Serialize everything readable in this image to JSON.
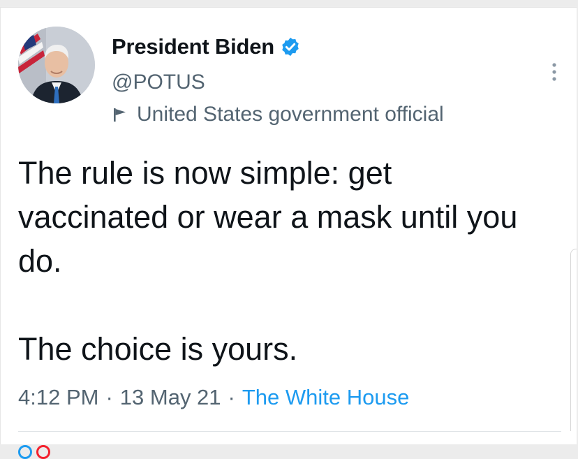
{
  "tweet": {
    "author": {
      "display_name": "President Biden",
      "handle": "@POTUS",
      "verified": true,
      "label": "United States government official",
      "avatar_icon": "president-portrait"
    },
    "text": {
      "paragraph_1": "The rule is now simple: get vaccinated or wear a mask until you do.",
      "paragraph_2": "The choice is yours."
    },
    "meta": {
      "time": "4:12 PM",
      "separator": "·",
      "date": "13 May 21",
      "source": "The White House"
    },
    "more_icon": "more-vertical-icon"
  },
  "colors": {
    "text_primary": "#0f1419",
    "text_secondary": "#536471",
    "accent": "#1d9bf0",
    "background": "#ffffff"
  }
}
